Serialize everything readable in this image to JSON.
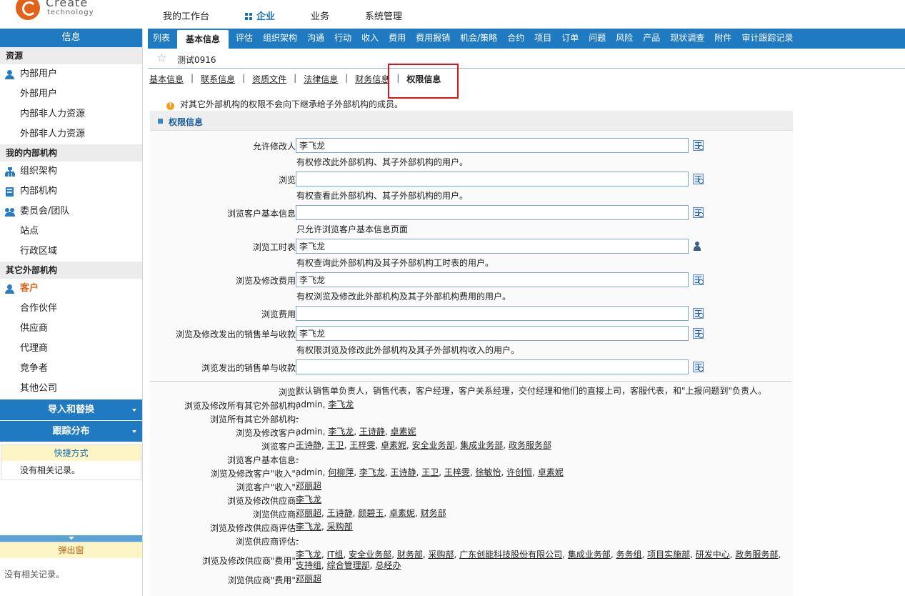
{
  "header": {
    "logo_text": "Create",
    "logo_sub": "technology",
    "nav": [
      {
        "label": "我的工作台",
        "active": false
      },
      {
        "label": "企业",
        "active": true
      },
      {
        "label": "业务",
        "active": false
      },
      {
        "label": "系统管理",
        "active": false
      }
    ]
  },
  "sidebar": {
    "title": "信息",
    "groups": [
      {
        "label": "资源",
        "items": [
          {
            "label": "内部用户",
            "icon": "user-icon"
          },
          {
            "label": "外部用户"
          },
          {
            "label": "内部非人力资源"
          },
          {
            "label": "外部非人力资源"
          }
        ]
      },
      {
        "label": "我的内部机构",
        "items": [
          {
            "label": "组织架构",
            "icon": "org-chart-icon"
          },
          {
            "label": "内部机构",
            "icon": "building-icon"
          },
          {
            "label": "委员会/团队",
            "icon": "team-icon"
          },
          {
            "label": "站点"
          },
          {
            "label": "行政区域"
          }
        ]
      },
      {
        "label": "其它外部机构",
        "items": [
          {
            "label": "客户",
            "icon": "user-icon",
            "active": true
          },
          {
            "label": "合作伙伴"
          },
          {
            "label": "供应商"
          },
          {
            "label": "代理商"
          },
          {
            "label": "竞争者"
          },
          {
            "label": "其他公司"
          }
        ]
      }
    ],
    "import_label": "导入和替换",
    "track_label": "跟踪分布",
    "shortcut_title": "快捷方式",
    "shortcut_empty": "没有相关记录。",
    "popup_title": "弹出窗",
    "popup_empty": "没有相关记录。"
  },
  "tabs": [
    "列表",
    "基本信息",
    "评估",
    "组织架构",
    "沟通",
    "行动",
    "收入",
    "费用",
    "费用报销",
    "机会/策略",
    "合约",
    "项目",
    "订单",
    "问题",
    "风险",
    "产品",
    "现状调查",
    "附件",
    "审计跟踪记录"
  ],
  "active_tab": "基本信息",
  "record_name": "测试0916",
  "subnav": [
    "基本信息",
    "联系信息",
    "资质文件",
    "法律信息",
    "财务信息",
    "权限信息"
  ],
  "notice": "对其它外部机构的权限不会向下继承给子外部机构的成员。",
  "section_title": "权限信息",
  "form": {
    "rows": [
      {
        "label": "允许修改人:",
        "value": "李飞龙",
        "hint": "有权修改此外部机构、其子外部机构的用户。"
      },
      {
        "label": "浏览:",
        "value": "",
        "hint": "有权查看此外部机构、其子外部机构的用户。"
      },
      {
        "label": "浏览客户基本信息:",
        "value": "",
        "hint": "只允许浏览客户基本信息页面"
      },
      {
        "label": "浏览工时表:",
        "value": "李飞龙",
        "hint": "有权查询此外部机构及其子外部机构工时表的用户。"
      },
      {
        "label": "浏览及修改费用:",
        "value": "李飞龙",
        "hint": "有权浏览及修改此外部机构及其子外部机构费用的用户。"
      },
      {
        "label": "浏览费用:",
        "value": "",
        "hint": ""
      },
      {
        "label": "浏览及修改发出的销售单与收款:",
        "value": "李飞龙",
        "hint": "有权限浏览及修改此外部机构及其子外部机构收入的用户。"
      },
      {
        "label": "浏览发出的销售单与收款:",
        "value": "",
        "hint": ""
      }
    ]
  },
  "info": [
    {
      "label": "浏览:",
      "plain": "默认销售单负责人，销售代表，客户经理，客户关系经理，交付经理和他们的直接上司，客服代表，和\"上报问题到\"负责人。",
      "links": []
    },
    {
      "label": "浏览及修改所有其它外部机构:",
      "plain": "admin, ",
      "links": [
        "李飞龙"
      ]
    },
    {
      "label": "浏览所有其它外部机构:",
      "plain": "-",
      "links": []
    },
    {
      "label": "浏览及修改客户:",
      "plain": "admin, ",
      "links": [
        "李飞龙",
        "王诗静",
        "卓素妮"
      ]
    },
    {
      "label": "浏览客户:",
      "plain": "",
      "links": [
        "王诗静",
        "王卫",
        "王梓雯",
        "卓素妮",
        "安全业务部",
        "集成业务部",
        "政务服务部"
      ]
    },
    {
      "label": "浏览客户基本信息:",
      "plain": "-",
      "links": []
    },
    {
      "label": "浏览及修改客户\"收入\":",
      "plain": "admin, ",
      "links": [
        "何柳萍",
        "李飞龙",
        "王诗静",
        "王卫",
        "王梓雯",
        "徐敏怡",
        "许创恒",
        "卓素妮"
      ]
    },
    {
      "label": "浏览客户\"收入\":",
      "plain": "",
      "links": [
        "邓丽超"
      ]
    },
    {
      "label": "浏览及修改供应商:",
      "plain": "",
      "links": [
        "李飞龙"
      ]
    },
    {
      "label": "浏览供应商:",
      "plain": "",
      "links": [
        "邓丽超",
        "王诗静",
        "颜碧玉",
        "卓素妮",
        "财务部"
      ]
    },
    {
      "label": "浏览及修改供应商评估:",
      "plain": "",
      "links": [
        "李飞龙",
        "采购部"
      ]
    },
    {
      "label": "浏览供应商评估:",
      "plain": "-",
      "links": []
    },
    {
      "label": "浏览及修改供应商\"费用\":",
      "plain": "",
      "links": [
        "李飞龙",
        "IT组",
        "安全业务部",
        "财务部",
        "采购部",
        "广东创能科技股份有限公司",
        "集成业务部",
        "务务组",
        "项目实施部",
        "研发中心",
        "政务服务部",
        "支持组",
        "综合管理部",
        "总经办"
      ]
    },
    {
      "label": "浏览供应商\"费用\":",
      "plain": "",
      "links": [
        "邓丽超"
      ]
    }
  ]
}
